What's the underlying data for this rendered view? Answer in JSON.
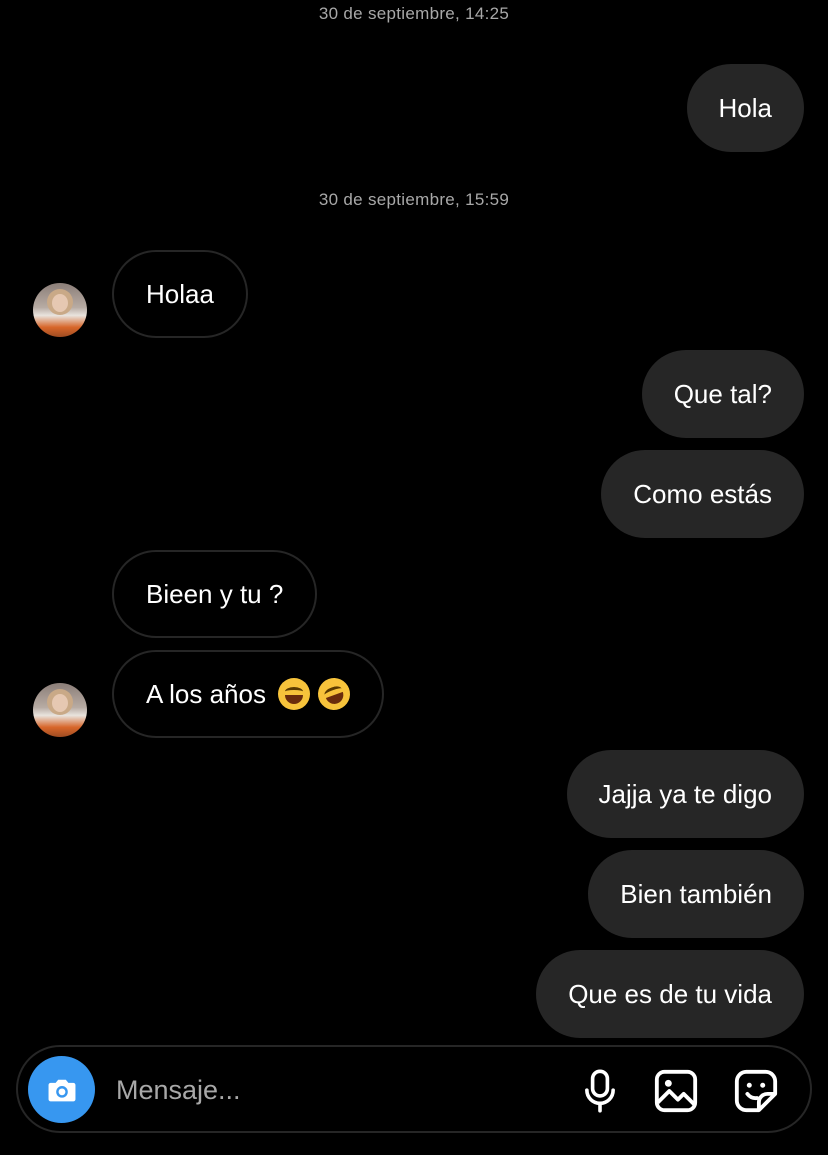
{
  "conversation": {
    "timestamps": [
      "30 de septiembre, 14:25",
      "30 de septiembre, 15:59"
    ],
    "messages": [
      {
        "from": "me",
        "text": "Hola"
      },
      {
        "from": "contact",
        "text": "Holaa"
      },
      {
        "from": "me",
        "text": "Que tal?"
      },
      {
        "from": "me",
        "text": "Como estás"
      },
      {
        "from": "contact",
        "text": "Bieen y tu ?"
      },
      {
        "from": "contact",
        "text": "A los años",
        "emojis": [
          "sweat-smile-emoji",
          "rofl-emoji"
        ]
      },
      {
        "from": "me",
        "text": "Jajja ya te digo"
      },
      {
        "from": "me",
        "text": "Bien también"
      },
      {
        "from": "me",
        "text": "Que es de tu vida"
      }
    ]
  },
  "composer": {
    "placeholder": "Mensaje...",
    "icons": [
      "camera-icon",
      "microphone-icon",
      "image-icon",
      "sticker-icon"
    ]
  },
  "colors": {
    "background": "#000000",
    "sent_bubble": "#262626",
    "received_border": "#262626",
    "timestamp": "#a8a8a8",
    "camera_accent": "#3797f0"
  }
}
